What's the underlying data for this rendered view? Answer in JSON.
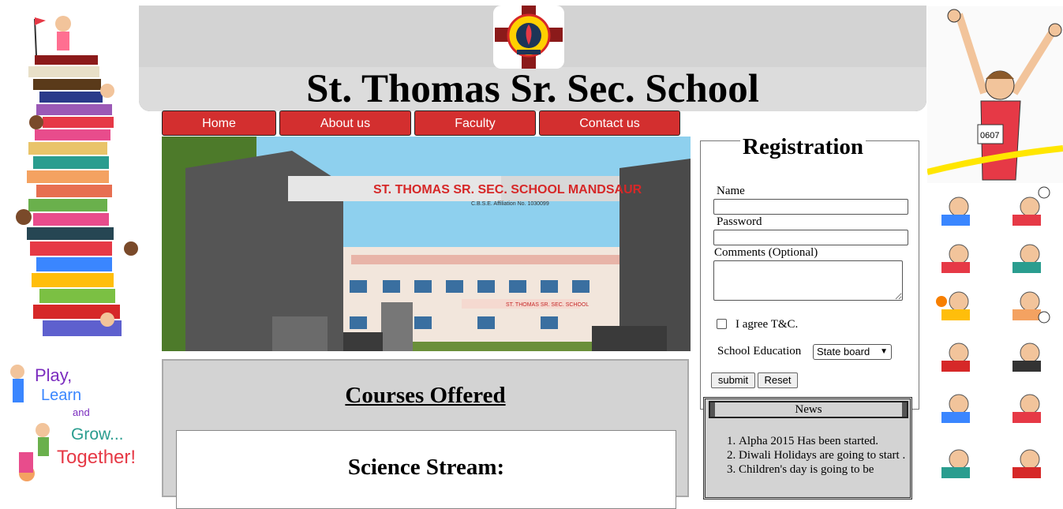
{
  "header": {
    "title": "St. Thomas Sr. Sec. School"
  },
  "nav": {
    "items": [
      {
        "label": "Home"
      },
      {
        "label": "About us"
      },
      {
        "label": "Faculty"
      },
      {
        "label": "Contact us"
      }
    ]
  },
  "hero": {
    "gate_sign": "ST. THOMAS SR. SEC. SCHOOL MANDSAUR",
    "gate_subsign": "C.B.S.E. Affiliation No. 1030099",
    "building_sign": "ST. THOMAS SR. SEC. SCHOOL"
  },
  "decor": {
    "play_learn": [
      "Play,",
      "Learn",
      "and",
      "Grow...",
      "Together!"
    ],
    "runner_bib": "0607"
  },
  "courses": {
    "title": "Courses Offered",
    "stream_title": "Science Stream:"
  },
  "registration": {
    "legend": "Registration",
    "name_label": "Name",
    "name_value": "",
    "password_label": "Password",
    "password_value": "",
    "comments_label": "Comments (Optional)",
    "agree_label": "I agree T&C.",
    "agree_checked": false,
    "education_label": "School Education",
    "education_selected": "Board",
    "education_option_prefix": "State board",
    "submit_label": "submit",
    "reset_label": "Reset"
  },
  "news": {
    "title": "News",
    "items": [
      "Alpha 2015 Has been started.",
      "Diwali Holidays are going to start .",
      "Children's day is going to be"
    ]
  },
  "colors": {
    "nav_red": "#d32f2f",
    "header_gray": "#d3d3d3"
  }
}
